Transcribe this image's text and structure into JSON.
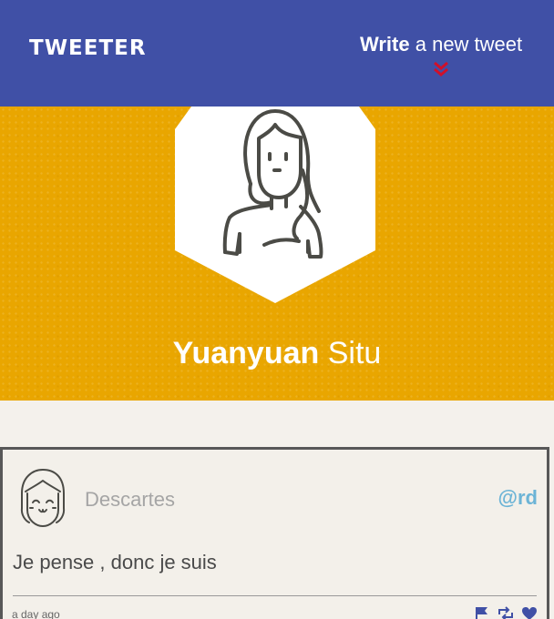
{
  "nav": {
    "brand": "TWEETER",
    "compose_bold": "Write",
    "compose_rest": "a new tweet"
  },
  "profile": {
    "first_name": "Yuanyuan",
    "last_name": "Situ"
  },
  "tweet": {
    "author": "Descartes",
    "handle": "@rd",
    "text": "Je pense , donc je suis",
    "time": "a day ago"
  },
  "icons": {
    "chevron": "double-chevron-down-icon",
    "flag": "flag-icon",
    "retweet": "retweet-icon",
    "like": "heart-icon"
  },
  "colors": {
    "nav": "#4050a6",
    "banner": "#e9a600",
    "chevron": "#d0102a",
    "handle": "#6cb4d6",
    "action_icons": "#4050a6"
  }
}
